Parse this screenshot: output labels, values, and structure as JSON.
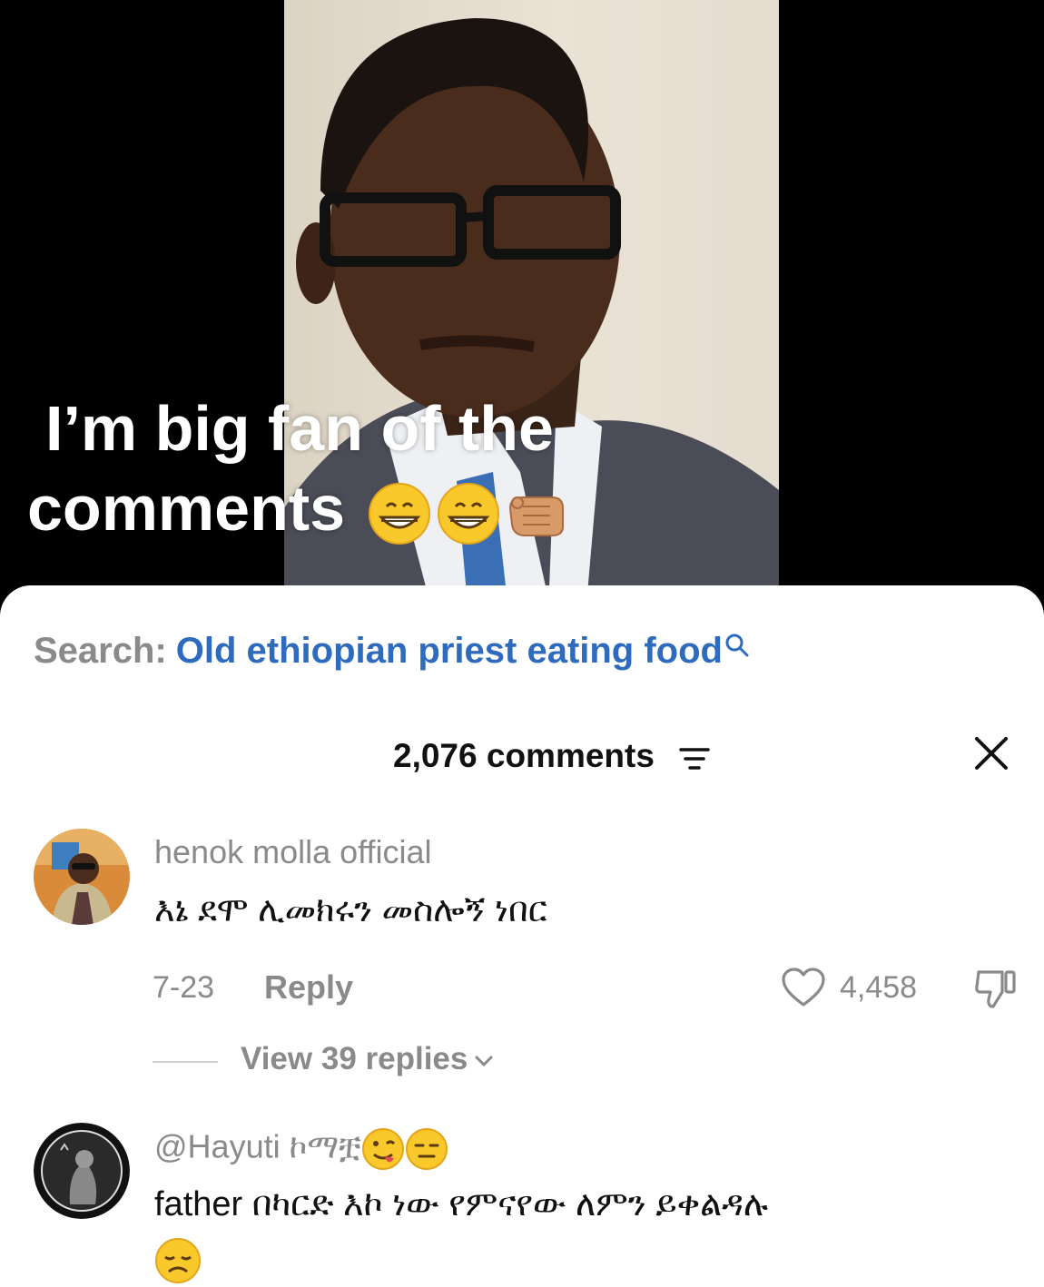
{
  "video": {
    "caption_line1": "I’m big fan of the",
    "caption_line2": "comments",
    "caption_emojis": [
      "grinning-face-emoji",
      "grinning-face-emoji",
      "pointing-fist-emoji"
    ]
  },
  "search": {
    "label": "Search:",
    "query": "Old ethiopian priest eating food",
    "icon": "search-icon"
  },
  "header": {
    "comments_count": "2,076 comments",
    "sort_icon": "sort-icon",
    "close_icon": "close-icon"
  },
  "comments": [
    {
      "username": "henok molla official",
      "text": "እኔ ደሞ ሊመክሩን መስሎኝ ነበር",
      "date": "7-23",
      "reply_label": "Reply",
      "likes": "4,458",
      "view_replies": "View 39 replies"
    },
    {
      "username": "@Hayuti ኮማቿ",
      "username_emojis": [
        "winking-tongue-emoji",
        "expressionless-emoji"
      ],
      "text": "father በካርድ እኮ ነው የምናየው ለምን ይቀልዳሉ",
      "text_emoji": "disappointed-emoji"
    }
  ],
  "colors": {
    "accent_blue": "#2e6bbd",
    "muted_gray": "#8a8a8a",
    "text_dark": "#111111",
    "sheet_bg": "#ffffff",
    "video_bg": "#000000"
  }
}
